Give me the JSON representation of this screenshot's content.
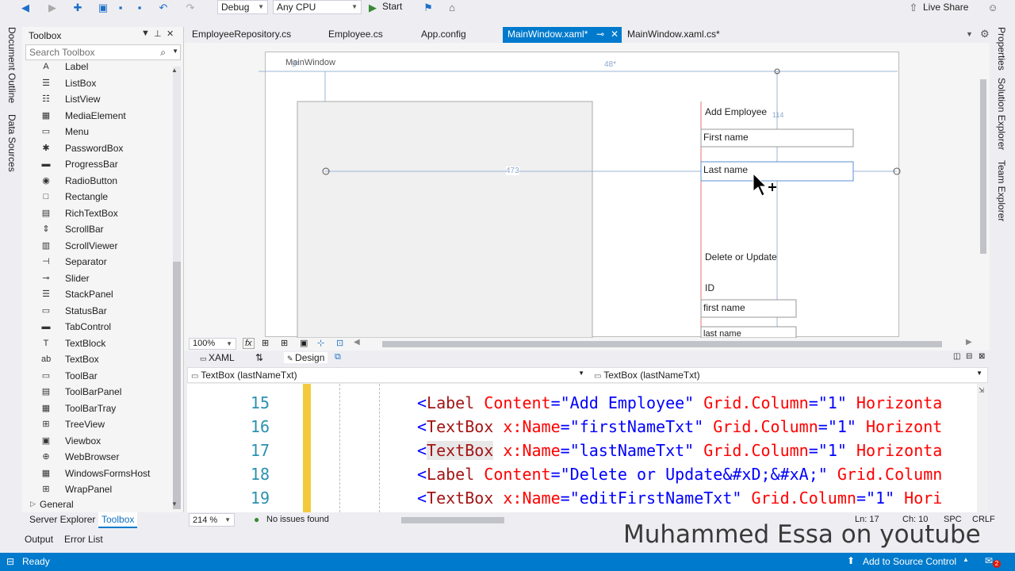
{
  "toolbar": {
    "config": "Debug",
    "platform": "Any CPU",
    "start": "Start",
    "live_share": "Live Share"
  },
  "left_strip": {
    "doc_outline": "Document Outline",
    "data_sources": "Data Sources"
  },
  "toolbox": {
    "title": "Toolbox",
    "search_placeholder": "Search Toolbox",
    "items": [
      {
        "label": "Label",
        "icon": "label-icon",
        "glyph": "A"
      },
      {
        "label": "ListBox",
        "icon": "listbox-icon",
        "glyph": "☰"
      },
      {
        "label": "ListView",
        "icon": "listview-icon",
        "glyph": "☷"
      },
      {
        "label": "MediaElement",
        "icon": "media-icon",
        "glyph": "▦"
      },
      {
        "label": "Menu",
        "icon": "menu-icon",
        "glyph": "▭"
      },
      {
        "label": "PasswordBox",
        "icon": "password-icon",
        "glyph": "✱"
      },
      {
        "label": "ProgressBar",
        "icon": "progressbar-icon",
        "glyph": "▬"
      },
      {
        "label": "RadioButton",
        "icon": "radio-icon",
        "glyph": "◉"
      },
      {
        "label": "Rectangle",
        "icon": "rectangle-icon",
        "glyph": "□"
      },
      {
        "label": "RichTextBox",
        "icon": "richtextbox-icon",
        "glyph": "▤"
      },
      {
        "label": "ScrollBar",
        "icon": "scrollbar-icon",
        "glyph": "⇕"
      },
      {
        "label": "ScrollViewer",
        "icon": "scrollviewer-icon",
        "glyph": "▥"
      },
      {
        "label": "Separator",
        "icon": "separator-icon",
        "glyph": "⊣"
      },
      {
        "label": "Slider",
        "icon": "slider-icon",
        "glyph": "⊸"
      },
      {
        "label": "StackPanel",
        "icon": "stackpanel-icon",
        "glyph": "☰"
      },
      {
        "label": "StatusBar",
        "icon": "statusbar-icon",
        "glyph": "▭"
      },
      {
        "label": "TabControl",
        "icon": "tabcontrol-icon",
        "glyph": "▬"
      },
      {
        "label": "TextBlock",
        "icon": "textblock-icon",
        "glyph": "T"
      },
      {
        "label": "TextBox",
        "icon": "textbox-icon",
        "glyph": "ab"
      },
      {
        "label": "ToolBar",
        "icon": "toolbar-icon",
        "glyph": "▭"
      },
      {
        "label": "ToolBarPanel",
        "icon": "toolbarpanel-icon",
        "glyph": "▤"
      },
      {
        "label": "ToolBarTray",
        "icon": "toolbartray-icon",
        "glyph": "▦"
      },
      {
        "label": "TreeView",
        "icon": "treeview-icon",
        "glyph": "⊞"
      },
      {
        "label": "Viewbox",
        "icon": "viewbox-icon",
        "glyph": "▣"
      },
      {
        "label": "WebBrowser",
        "icon": "webbrowser-icon",
        "glyph": "⊕"
      },
      {
        "label": "WindowsFormsHost",
        "icon": "formshost-icon",
        "glyph": "▦"
      },
      {
        "label": "WrapPanel",
        "icon": "wrappanel-icon",
        "glyph": "⊞"
      }
    ],
    "general": "General"
  },
  "bottom_tabs": {
    "server_explorer": "Server Explorer",
    "toolbox": "Toolbox",
    "output": "Output",
    "error_list": "Error List"
  },
  "editor_tabs": [
    "EmployeeRepository.cs",
    "Employee.cs",
    "App.config",
    "MainWindow.xaml*",
    "MainWindow.xaml.cs*"
  ],
  "designer": {
    "window_title": "MainWindow",
    "dim_top": "48*",
    "dim_mid": "473",
    "dim_side": "114",
    "dim_small": "5*",
    "add_employee": "Add Employee",
    "first_name": "First name",
    "last_name": "Last name",
    "delete_update": "Delete or Update",
    "id_label": "ID",
    "first_name_small": "first name",
    "last_name_small": "last name"
  },
  "viewbar": {
    "zoom": "100%",
    "fx": "fx"
  },
  "split": {
    "xaml": "XAML",
    "design": "Design"
  },
  "path": {
    "left": "TextBox (lastNameTxt)",
    "right": "TextBox (lastNameTxt)"
  },
  "code": {
    "lines": [
      {
        "n": "15",
        "p1": "<",
        "tag": "Label",
        "a1": " Content",
        "eq1": "=",
        "v1": "\"Add Employee\"",
        "a2": " Grid.Column",
        "eq2": "=",
        "v2": "\"1\"",
        "a3": " Horizonta"
      },
      {
        "n": "16",
        "p1": "<",
        "tag": "TextBox",
        "a1": " x:Name",
        "eq1": "=",
        "v1": "\"firstNameTxt\"",
        "a2": " Grid.Column",
        "eq2": "=",
        "v2": "\"1\"",
        "a3": " Horizont"
      },
      {
        "n": "17",
        "p1": "<",
        "tag": "TextBox",
        "a1": " x:Name",
        "eq1": "=",
        "v1": "\"lastNameTxt\"",
        "a2": " Grid.Column",
        "eq2": "=",
        "v2": "\"1\"",
        "a3": " Horizonta"
      },
      {
        "n": "18",
        "p1": "<",
        "tag": "Label",
        "a1": " Content",
        "eq1": "=",
        "v1": "\"Delete or Update&#xD;&#xA;\"",
        "a2": " Grid.Column",
        "eq2": "",
        "v2": "",
        "a3": ""
      },
      {
        "n": "19",
        "p1": "<",
        "tag": "TextBox",
        "a1": " x:Name",
        "eq1": "=",
        "v1": "\"editFirstNameTxt\"",
        "a2": " Grid.Column",
        "eq2": "=",
        "v2": "\"1\"",
        "a3": " Hori"
      }
    ]
  },
  "editor_status": {
    "zoom": "214 %",
    "issues": "No issues found",
    "ln": "Ln: 17",
    "ch": "Ch: 10",
    "spc": "SPC",
    "crlf": "CRLF"
  },
  "statusbar": {
    "ready": "Ready",
    "source_control": "Add to Source Control",
    "notif_count": "2"
  },
  "right_strip": {
    "properties": "Properties",
    "solution_explorer": "Solution Explorer",
    "team_explorer": "Team Explorer"
  },
  "watermark": "Muhammed Essa on youtube"
}
